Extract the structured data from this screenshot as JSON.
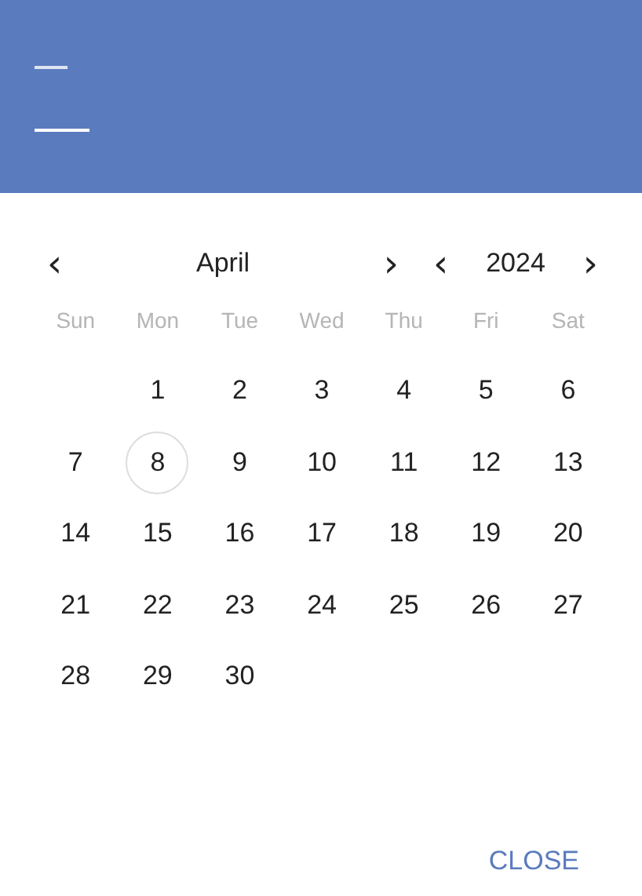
{
  "header": {
    "color": "#5a7bbd"
  },
  "month_nav": {
    "prev": "‹",
    "label": "April",
    "next": "›"
  },
  "year_nav": {
    "prev": "‹",
    "label": "2024",
    "next": "›"
  },
  "weekdays": [
    "Sun",
    "Mon",
    "Tue",
    "Wed",
    "Thu",
    "Fri",
    "Sat"
  ],
  "weeks": [
    {
      "kind": "first",
      "days": [
        {
          "label": "1",
          "today": false
        },
        {
          "label": "2",
          "today": false
        },
        {
          "label": "3",
          "today": false
        },
        {
          "label": "4",
          "today": false
        },
        {
          "label": "5",
          "today": false
        },
        {
          "label": "6",
          "today": false
        }
      ]
    },
    {
      "kind": "full",
      "days": [
        {
          "label": "7",
          "today": false
        },
        {
          "label": "8",
          "today": true
        },
        {
          "label": "9",
          "today": false
        },
        {
          "label": "10",
          "today": false
        },
        {
          "label": "11",
          "today": false
        },
        {
          "label": "12",
          "today": false
        },
        {
          "label": "13",
          "today": false
        }
      ]
    },
    {
      "kind": "full",
      "days": [
        {
          "label": "14",
          "today": false
        },
        {
          "label": "15",
          "today": false
        },
        {
          "label": "16",
          "today": false
        },
        {
          "label": "17",
          "today": false
        },
        {
          "label": "18",
          "today": false
        },
        {
          "label": "19",
          "today": false
        },
        {
          "label": "20",
          "today": false
        }
      ]
    },
    {
      "kind": "full",
      "days": [
        {
          "label": "21",
          "today": false
        },
        {
          "label": "22",
          "today": false
        },
        {
          "label": "23",
          "today": false
        },
        {
          "label": "24",
          "today": false
        },
        {
          "label": "25",
          "today": false
        },
        {
          "label": "26",
          "today": false
        },
        {
          "label": "27",
          "today": false
        }
      ]
    },
    {
      "kind": "last",
      "days": [
        {
          "label": "28",
          "today": false
        },
        {
          "label": "29",
          "today": false
        },
        {
          "label": "30",
          "today": false
        }
      ]
    }
  ],
  "buttons": [
    "CLOSE"
  ]
}
